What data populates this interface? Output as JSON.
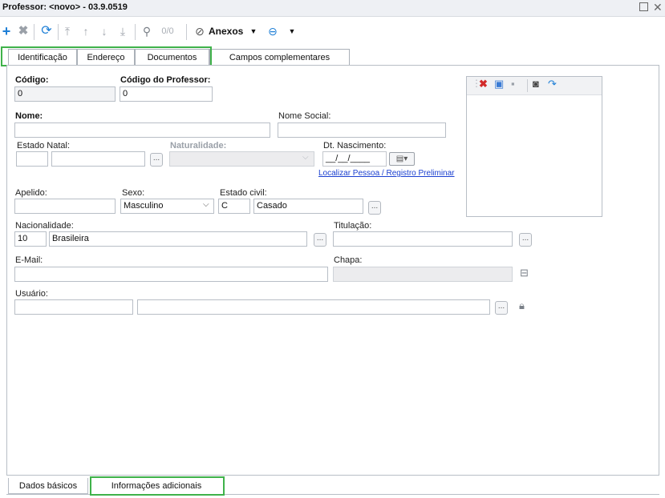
{
  "window": {
    "title": "Professor: <novo> - 03.9.0519"
  },
  "toolbar": {
    "page_counter": "0/0",
    "attachments_label": "Anexos"
  },
  "tabs": [
    {
      "label": "Identificação"
    },
    {
      "label": "Endereço"
    },
    {
      "label": "Documentos"
    },
    {
      "label": "Campos complementares"
    }
  ],
  "form": {
    "codigo": {
      "label": "Código:",
      "value": "0"
    },
    "codigo_professor": {
      "label": "Código do Professor:",
      "value": "0"
    },
    "nome": {
      "label": "Nome:",
      "value": ""
    },
    "nome_social": {
      "label": "Nome Social:",
      "value": ""
    },
    "estado_natal": {
      "label": "Estado Natal:",
      "code": "",
      "value": ""
    },
    "naturalidade": {
      "label": "Naturalidade:",
      "value": ""
    },
    "dt_nascimento": {
      "label": "Dt. Nascimento:",
      "value": "__/__/____"
    },
    "localizar_link": "Localizar Pessoa / Registro Preliminar",
    "apelido": {
      "label": "Apelido:",
      "value": ""
    },
    "sexo": {
      "label": "Sexo:",
      "value": "Masculino"
    },
    "estado_civil": {
      "label": "Estado civil:",
      "code": "C",
      "value": "Casado"
    },
    "nacionalidade": {
      "label": "Nacionalidade:",
      "code": "10",
      "value": "Brasileira"
    },
    "titulacao": {
      "label": "Titulação:",
      "value": ""
    },
    "email": {
      "label": "E-Mail:",
      "value": ""
    },
    "chapa": {
      "label": "Chapa:",
      "value": ""
    },
    "usuario": {
      "label": "Usuário:",
      "code": "",
      "value": ""
    },
    "ellipsis": "..."
  },
  "bottom_tabs": [
    {
      "label": "Dados básicos"
    },
    {
      "label": "Informações adicionais"
    }
  ],
  "colors": {
    "highlight": "#3fb24a",
    "link": "#1a3fd0",
    "add": "#1e7fd6",
    "delete": "#d22a2a"
  }
}
